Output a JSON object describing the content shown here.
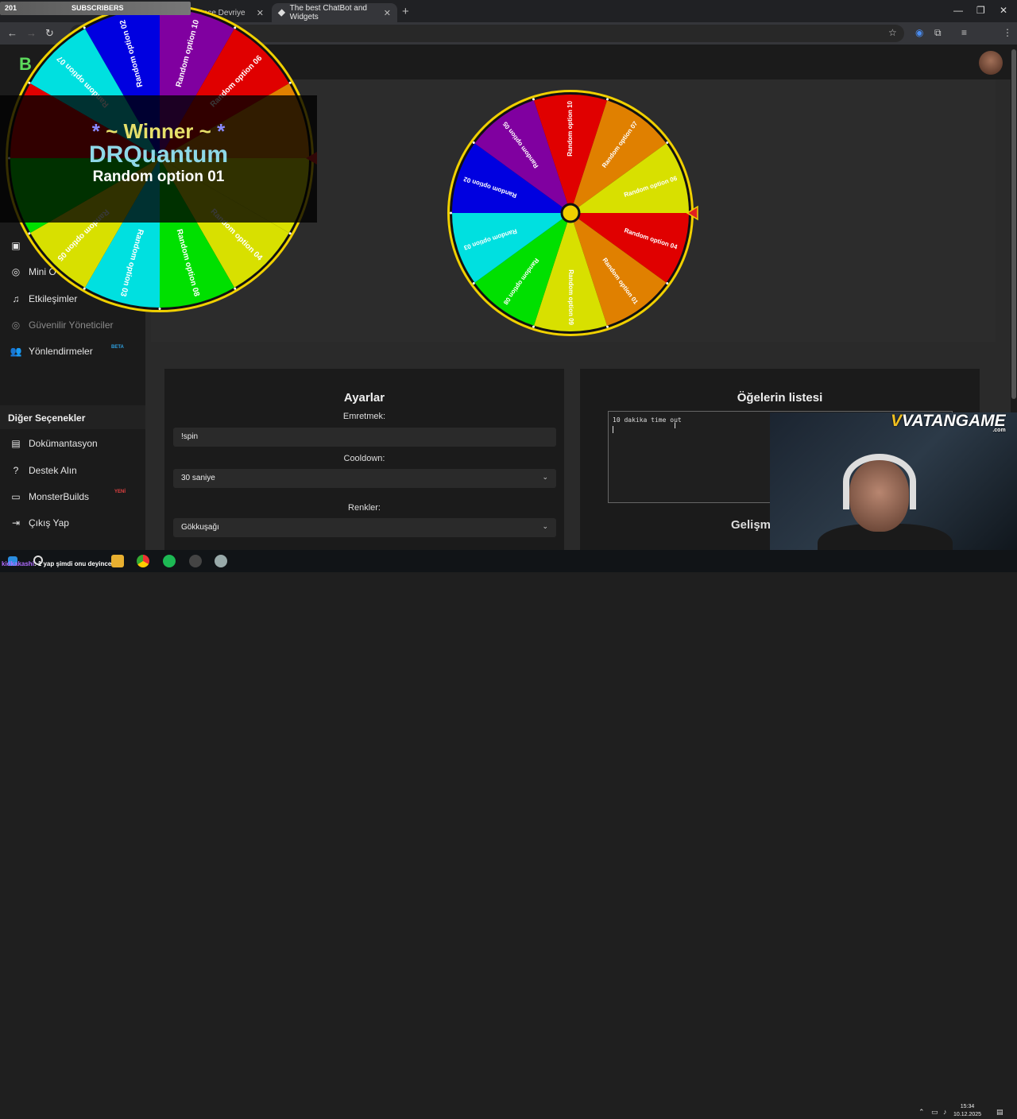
{
  "browser": {
    "tabs": [
      {
        "label": "Gece Devriye"
      },
      {
        "label": "The best ChatBot and Widgets"
      }
    ],
    "new_tab_icon": "plus-icon"
  },
  "stream": {
    "subscribers_count": "201",
    "subscribers_label": "SUBSCRIBERS",
    "winner_title_star": "*",
    "winner_title_text": "~ Winner ~",
    "winner_name": "DRQuantum",
    "winner_option": "Random option 01",
    "sponsor_v": "V",
    "sponsor_text": "VATANGAME",
    "sponsor_domain": ".com",
    "chat_user": "kidkakashi",
    "chat_text": ": 1 yap şimdi onu deyince"
  },
  "site": {
    "logo_letter": "B",
    "sidebar": {
      "items": [
        {
          "label": "Mini O",
          "icon": "gamepad-icon"
        },
        {
          "label": "Etkileşimler",
          "icon": "music-icon"
        },
        {
          "label": "Güvenilir Yöneticiler",
          "icon": "gamepad-icon"
        },
        {
          "label": "Yönlendirmeler",
          "icon": "users-icon"
        }
      ],
      "beta_badge": "BETA",
      "section_title": "Diğer Seçenekler",
      "other_items": [
        {
          "label": "Dokümantasyon",
          "icon": "docs-icon"
        },
        {
          "label": "Destek Alın",
          "icon": "help-icon"
        },
        {
          "label": "MonsterBuilds",
          "icon": "monitor-icon"
        },
        {
          "label": "Çıkış Yap",
          "icon": "logout-icon"
        }
      ],
      "new_badge": "YENİ"
    }
  },
  "settings": {
    "title": "Ayarlar",
    "command_label": "Emretmek:",
    "command_value": "!spin",
    "cooldown_label": "Cooldown:",
    "cooldown_value": "30 saniye",
    "colors_label": "Renkler:",
    "colors_value": "Gökkuşağı"
  },
  "items_panel": {
    "title": "Öğelerin listesi",
    "textarea_value": "10 dakika time out",
    "advanced_title": "Gelişm"
  },
  "wheel": {
    "segments": [
      {
        "label": "Random option 10",
        "color": "#e00000"
      },
      {
        "label": "Random option 07",
        "color": "#e08000"
      },
      {
        "label": "Random option 06",
        "color": "#d8e000"
      },
      {
        "label": "Random option 04",
        "color": "#e00000"
      },
      {
        "label": "Random option 01",
        "color": "#e08000"
      },
      {
        "label": "Random option 09",
        "color": "#d8e000"
      },
      {
        "label": "Random option 08",
        "color": "#00e000"
      },
      {
        "label": "Random option 03",
        "color": "#00e0e0"
      },
      {
        "label": "Random option 02",
        "color": "#0000e0"
      },
      {
        "label": "Random option 05",
        "color": "#8000a0"
      }
    ]
  },
  "overlay_wheel": {
    "segments": [
      {
        "label": "Random option 02",
        "color": "#0000e0"
      },
      {
        "label": "Random option 10",
        "color": "#8000a0"
      },
      {
        "label": "Random option 06",
        "color": "#e00000"
      },
      {
        "label": "",
        "color": "#e08000"
      },
      {
        "label": "",
        "color": "#d8e000"
      },
      {
        "label": "Random option 04",
        "color": "#d8e000"
      },
      {
        "label": "Random option 08",
        "color": "#00e000"
      },
      {
        "label": "Random option 03",
        "color": "#00e0e0"
      },
      {
        "label": "Random option 05",
        "color": "#d8e000"
      },
      {
        "label": "",
        "color": "#00e000"
      },
      {
        "label": "",
        "color": "#e00000"
      },
      {
        "label": "Random option 07",
        "color": "#00e0e0"
      }
    ]
  },
  "taskbar": {
    "time": "15:34",
    "date": "10.12.2025"
  }
}
